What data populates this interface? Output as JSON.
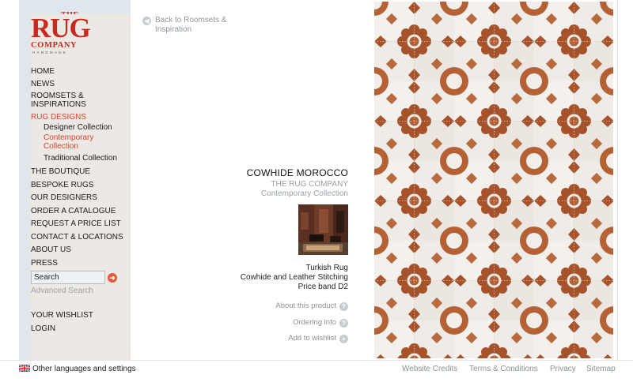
{
  "logo": {
    "the": "THE",
    "rug": "RUG",
    "company": "COMPANY",
    "handmade": "HANDMADE"
  },
  "nav": {
    "home": "HOME",
    "news": "NEWS",
    "roomsets": "ROOMSETS & INSPIRATIONS",
    "rug_designs": "RUG DESIGNS",
    "designer_collection": "Designer Collection",
    "contemporary_collection": "Contemporary Collection",
    "traditional_collection": "Traditional Collection",
    "boutique": "THE BOUTIQUE",
    "bespoke": "BESPOKE RUGS",
    "designers": "OUR DESIGNERS",
    "catalogue": "ORDER A CATALOGUE",
    "price_list": "REQUEST A PRICE LIST",
    "contact": "CONTACT & LOCATIONS",
    "about": "ABOUT US",
    "press": "PRESS",
    "wishlist": "YOUR WISHLIST",
    "login": "LOGIN"
  },
  "search": {
    "value": "Search",
    "advanced": "Advanced Search"
  },
  "main": {
    "back_label": "Back to Roomsets & Inspiration",
    "product_title": "COWHIDE MOROCCO",
    "brand": "THE RUG COMPANY",
    "collection": "Contemporary Collection",
    "spec_origin": "Turkish Rug",
    "spec_material": "Cowhide and Leather Stitching",
    "spec_price": "Price band D2",
    "about_product": "About this product",
    "ordering_info": "Ordering info",
    "add_to_wishlist": "Add to wishlist"
  },
  "footer": {
    "languages": "Other languages and settings",
    "credits": "Website Credits",
    "terms": "Terms & Conditions",
    "privacy": "Privacy",
    "sitemap": "Sitemap"
  },
  "colors": {
    "accent": "#d24632",
    "logo_red": "#c8281e",
    "rug_brown": "#a9572e",
    "rug_cream": "#f1ede8",
    "sidebar_bg": "#dfe6ec"
  },
  "icons": {
    "back": "arrow-left-circle-icon",
    "search_go": "arrow-right-circle-icon",
    "about": "question-circle-icon",
    "ordering": "question-circle-icon",
    "wishlist": "plus-circle-icon",
    "flag": "uk-flag-icon"
  }
}
